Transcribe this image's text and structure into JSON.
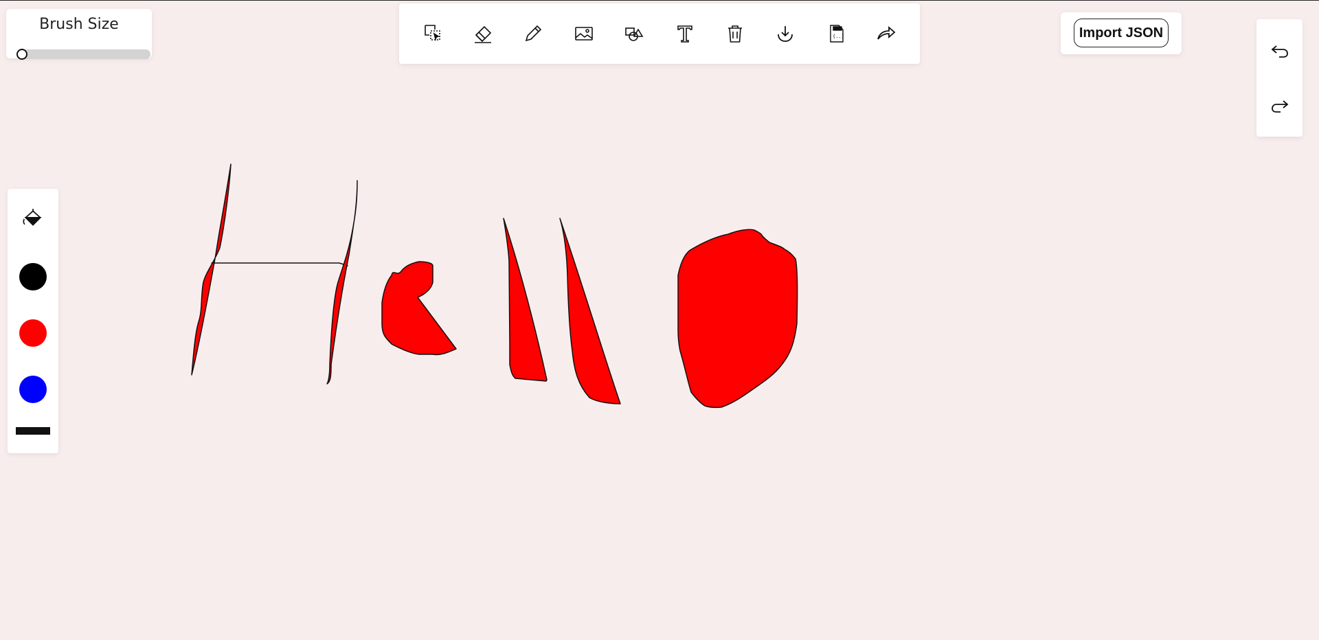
{
  "brush": {
    "title": "Brush Size",
    "value_fraction": 0.0
  },
  "toolbar": {
    "tools": [
      {
        "name": "select-tool",
        "icon": "select-icon"
      },
      {
        "name": "eraser-tool",
        "icon": "eraser-icon"
      },
      {
        "name": "pencil-tool",
        "icon": "pencil-icon"
      },
      {
        "name": "image-tool",
        "icon": "image-icon"
      },
      {
        "name": "shapes-tool",
        "icon": "shapes-icon"
      },
      {
        "name": "text-tool",
        "icon": "text-icon"
      },
      {
        "name": "delete-tool",
        "icon": "trash-icon"
      },
      {
        "name": "download-tool",
        "icon": "download-icon"
      },
      {
        "name": "export-json-tool",
        "icon": "json-file-icon"
      },
      {
        "name": "share-tool",
        "icon": "share-icon"
      }
    ]
  },
  "import": {
    "label": "Import JSON"
  },
  "history": {
    "undo_icon": "undo-icon",
    "redo_icon": "redo-icon"
  },
  "palette": {
    "fill_icon": "paint-bucket-icon",
    "colors": [
      "#000000",
      "#ff0000",
      "#0000ff"
    ],
    "stroke_color": "#111111"
  },
  "canvas": {
    "background": "#f8eded",
    "drawing_fill": "#ff0000",
    "drawing_stroke": "#111111"
  }
}
